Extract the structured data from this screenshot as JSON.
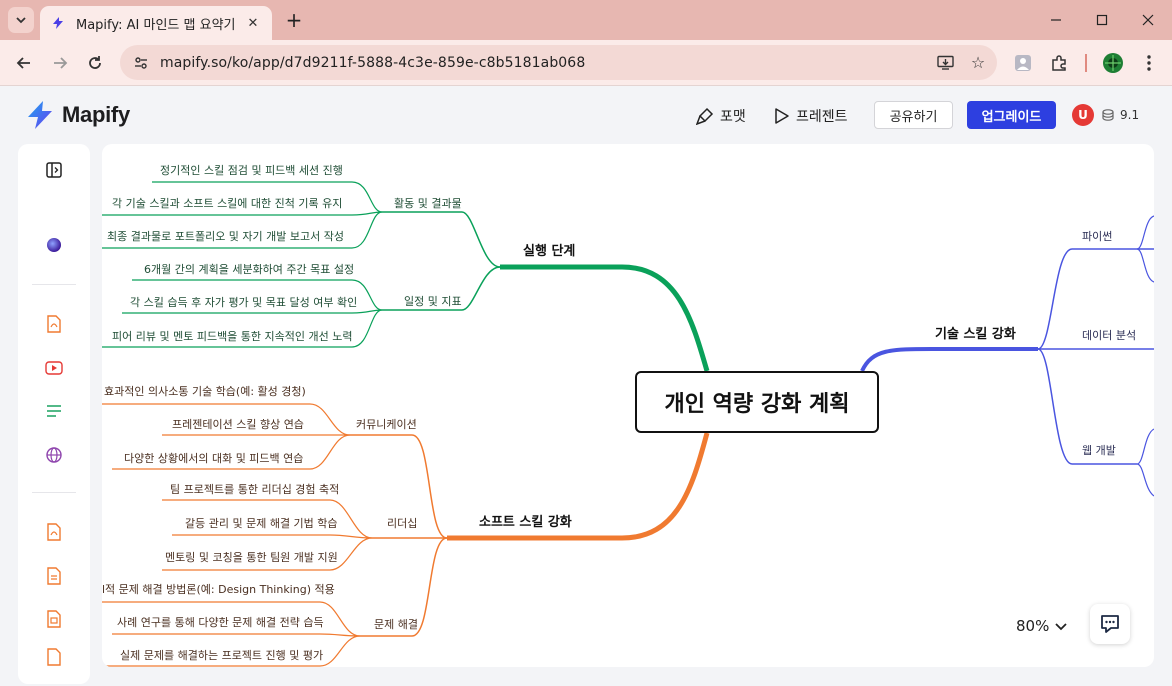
{
  "browser": {
    "tab_title": "Mapify: AI 마인드 맵 요약기",
    "url": "mapify.so/ko/app/d7d9211f-5888-4c3e-859e-c8b5181ab068",
    "window_controls": [
      "minimize-icon",
      "maximize-icon",
      "close-icon"
    ]
  },
  "header": {
    "brand": "Mapify",
    "format_label": "포맷",
    "present_label": "프레젠트",
    "share_label": "공유하기",
    "upgrade_label": "업그레이드",
    "avatar_initial": "U",
    "credits": "9.1",
    "colors": {
      "brand_gradient": [
        "#6a3cf0",
        "#1ea6f0"
      ],
      "upgrade_bg": "#2d3fe0",
      "avatar_bg": "#e53935"
    }
  },
  "sidebar": {
    "icons": [
      "sidebar-toggle-icon",
      "ai-orb-icon",
      "pdf-icon",
      "youtube-icon",
      "text-icon",
      "web-icon",
      "pdf-icon",
      "document-icon",
      "presentation-icon",
      "file-icon"
    ]
  },
  "mindmap": {
    "center": "개인 역량 강화 계획",
    "colors": {
      "execution": "#0aa15a",
      "soft": "#f07a30",
      "tech": "#4a55e0"
    },
    "execution": {
      "label": "실행 단계",
      "activities": {
        "label": "활동 및 결과물",
        "items": [
          "정기적인 스킬 점검 및 피드백 세션 진행",
          "각 기술 스킬과 소프트 스킬에 대한 진척 기록 유지",
          "최종 결과물로 포트폴리오 및 자기 개발 보고서 작성"
        ]
      },
      "schedule": {
        "label": "일정 및 지표",
        "items": [
          "6개월 간의 계획을 세분화하여 주간 목표 설정",
          "각 스킬 습득 후 자가 평가 및 목표 달성 여부 확인",
          "피어 리뷰 및 멘토 피드백을 통한 지속적인 개선 노력"
        ]
      }
    },
    "soft": {
      "label": "소프트 스킬 강화",
      "communication": {
        "label": "커뮤니케이션",
        "items": [
          "효과적인 의사소통 기술 학습(예: 활성 경청)",
          "프레젠테이션 스킬 향상 연습",
          "다양한 상황에서의 대화 및 피드백 연습"
        ]
      },
      "leadership": {
        "label": "리더십",
        "items": [
          "팀 프로젝트를 통한 리더십 경험 축적",
          "갈등 관리 및 문제 해결 기법 학습",
          "멘토링 및 코칭을 통한 팀원 개발 지원"
        ]
      },
      "problem": {
        "label": "문제 해결",
        "items": [
          "l적 문제 해결 방법론(예: Design Thinking) 적용",
          "사례 연구를 통해 다양한 문제 해결 전략 습득",
          "실제 문제를 해결하는 프로젝트 진행 및 평가"
        ]
      }
    },
    "tech": {
      "label": "기술 스킬 강화",
      "python": "파이썬",
      "data": "데이터 분석",
      "web": "웹 개발"
    },
    "zoom": "80%"
  }
}
